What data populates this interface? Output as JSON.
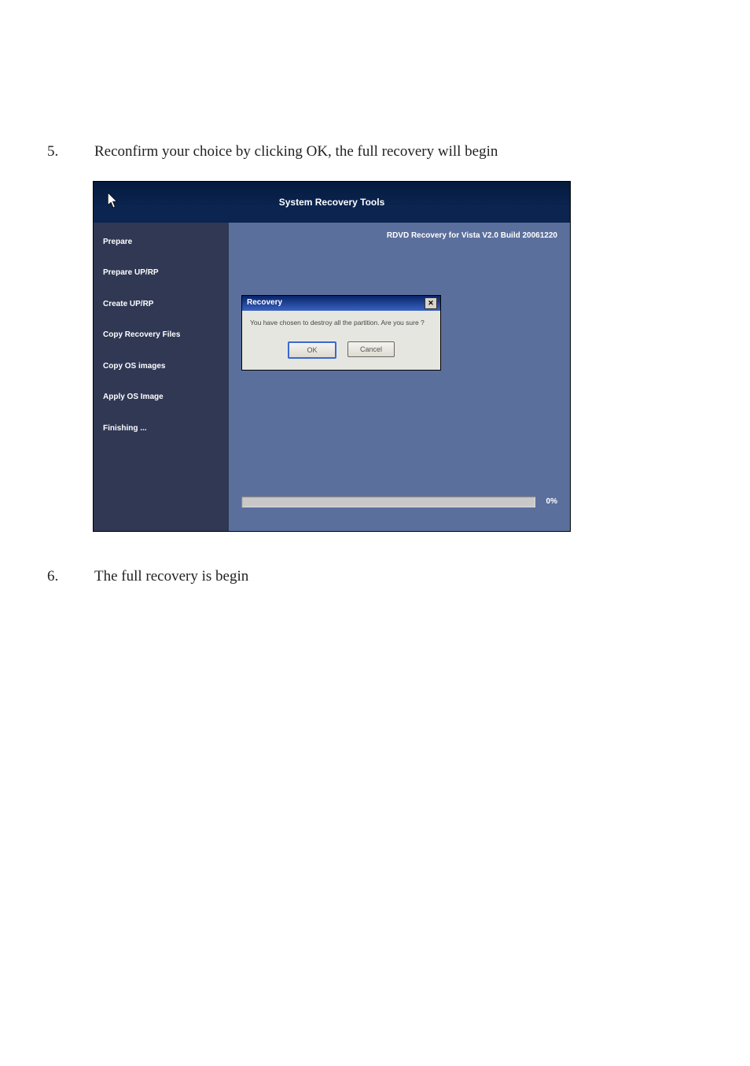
{
  "document": {
    "steps": {
      "s5": {
        "num": "5.",
        "text": "Reconfirm your choice by clicking OK, the full recovery will begin"
      },
      "s6": {
        "num": "6.",
        "text": "The full recovery is begin"
      }
    }
  },
  "window": {
    "title": "System Recovery Tools",
    "version": "RDVD Recovery for Vista V2.0 Build 20061220",
    "sidebar": {
      "prepare": "Prepare",
      "prepare_uprp": "Prepare UP/RP",
      "create_uprp": "Create UP/RP",
      "copy_recovery_files": "Copy Recovery Files",
      "copy_os_images": "Copy OS images",
      "apply_os_image": "Apply OS Image",
      "finishing": "Finishing ..."
    },
    "progress_pct": "0%"
  },
  "dialog": {
    "title": "Recovery",
    "message": "You have chosen to destroy all the partition. Are you sure ?",
    "ok": "OK",
    "cancel": "Cancel",
    "close_glyph": "✕"
  }
}
